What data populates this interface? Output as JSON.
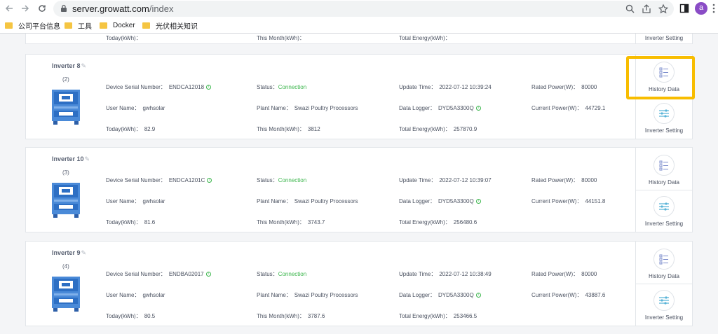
{
  "browser": {
    "url_host": "server.growatt.com",
    "url_path": "/index",
    "avatar_letter": "a",
    "bookmarks": [
      "公司平台信息",
      "工具",
      "Docker",
      "光伏相关知识"
    ]
  },
  "colors": {
    "connection": "#39b54a",
    "highlight": "#f8bd00",
    "inverter_blue": "#4a8ad8"
  },
  "partial_card": {
    "today_label": "Today(kWh)：",
    "month_label": "This Month(kWh)：",
    "energy_label": "Total Energy(kWh)：",
    "inverter_setting": "Inverter Setting"
  },
  "labels": {
    "serial": "Device Serial Number：",
    "status": "Status：",
    "update": "Update Time：",
    "rated": "Rated Power(W)：",
    "user": "User Name：",
    "plant": "Plant Name：",
    "logger": "Data Logger：",
    "current": "Current Power(W)：",
    "today": "Today(kWh)：",
    "month": "This Month(kWh)：",
    "total": "Total Energy(kWh)：",
    "history": "History Data",
    "setting": "Inverter Setting"
  },
  "inverters": [
    {
      "name": "Inverter 8",
      "index": "(2)",
      "serial": "ENDCA12018",
      "status": "Connection",
      "update_time": "2022-07-12 10:39:24",
      "rated_power": "80000",
      "user": "gwhsolar",
      "plant": "Swazi Poultry Processors",
      "logger": "DYD5A3300Q",
      "current_power": "44729.1",
      "today": "82.9",
      "month": "3812",
      "total": "257870.9"
    },
    {
      "name": "Inverter 10",
      "index": "(3)",
      "serial": "ENDCA1201C",
      "status": "Connection",
      "update_time": "2022-07-12 10:39:07",
      "rated_power": "80000",
      "user": "gwhsolar",
      "plant": "Swazi Poultry Processors",
      "logger": "DYD5A3300Q",
      "current_power": "44151.8",
      "today": "81.6",
      "month": "3743.7",
      "total": "256480.6"
    },
    {
      "name": "Inverter 9",
      "index": "(4)",
      "serial": "ENDBA02017",
      "status": "Connection",
      "update_time": "2022-07-12 10:38:49",
      "rated_power": "80000",
      "user": "gwhsolar",
      "plant": "Swazi Poultry Processors",
      "logger": "DYD5A3300Q",
      "current_power": "43887.6",
      "today": "80.5",
      "month": "3787.6",
      "total": "253466.5"
    }
  ]
}
